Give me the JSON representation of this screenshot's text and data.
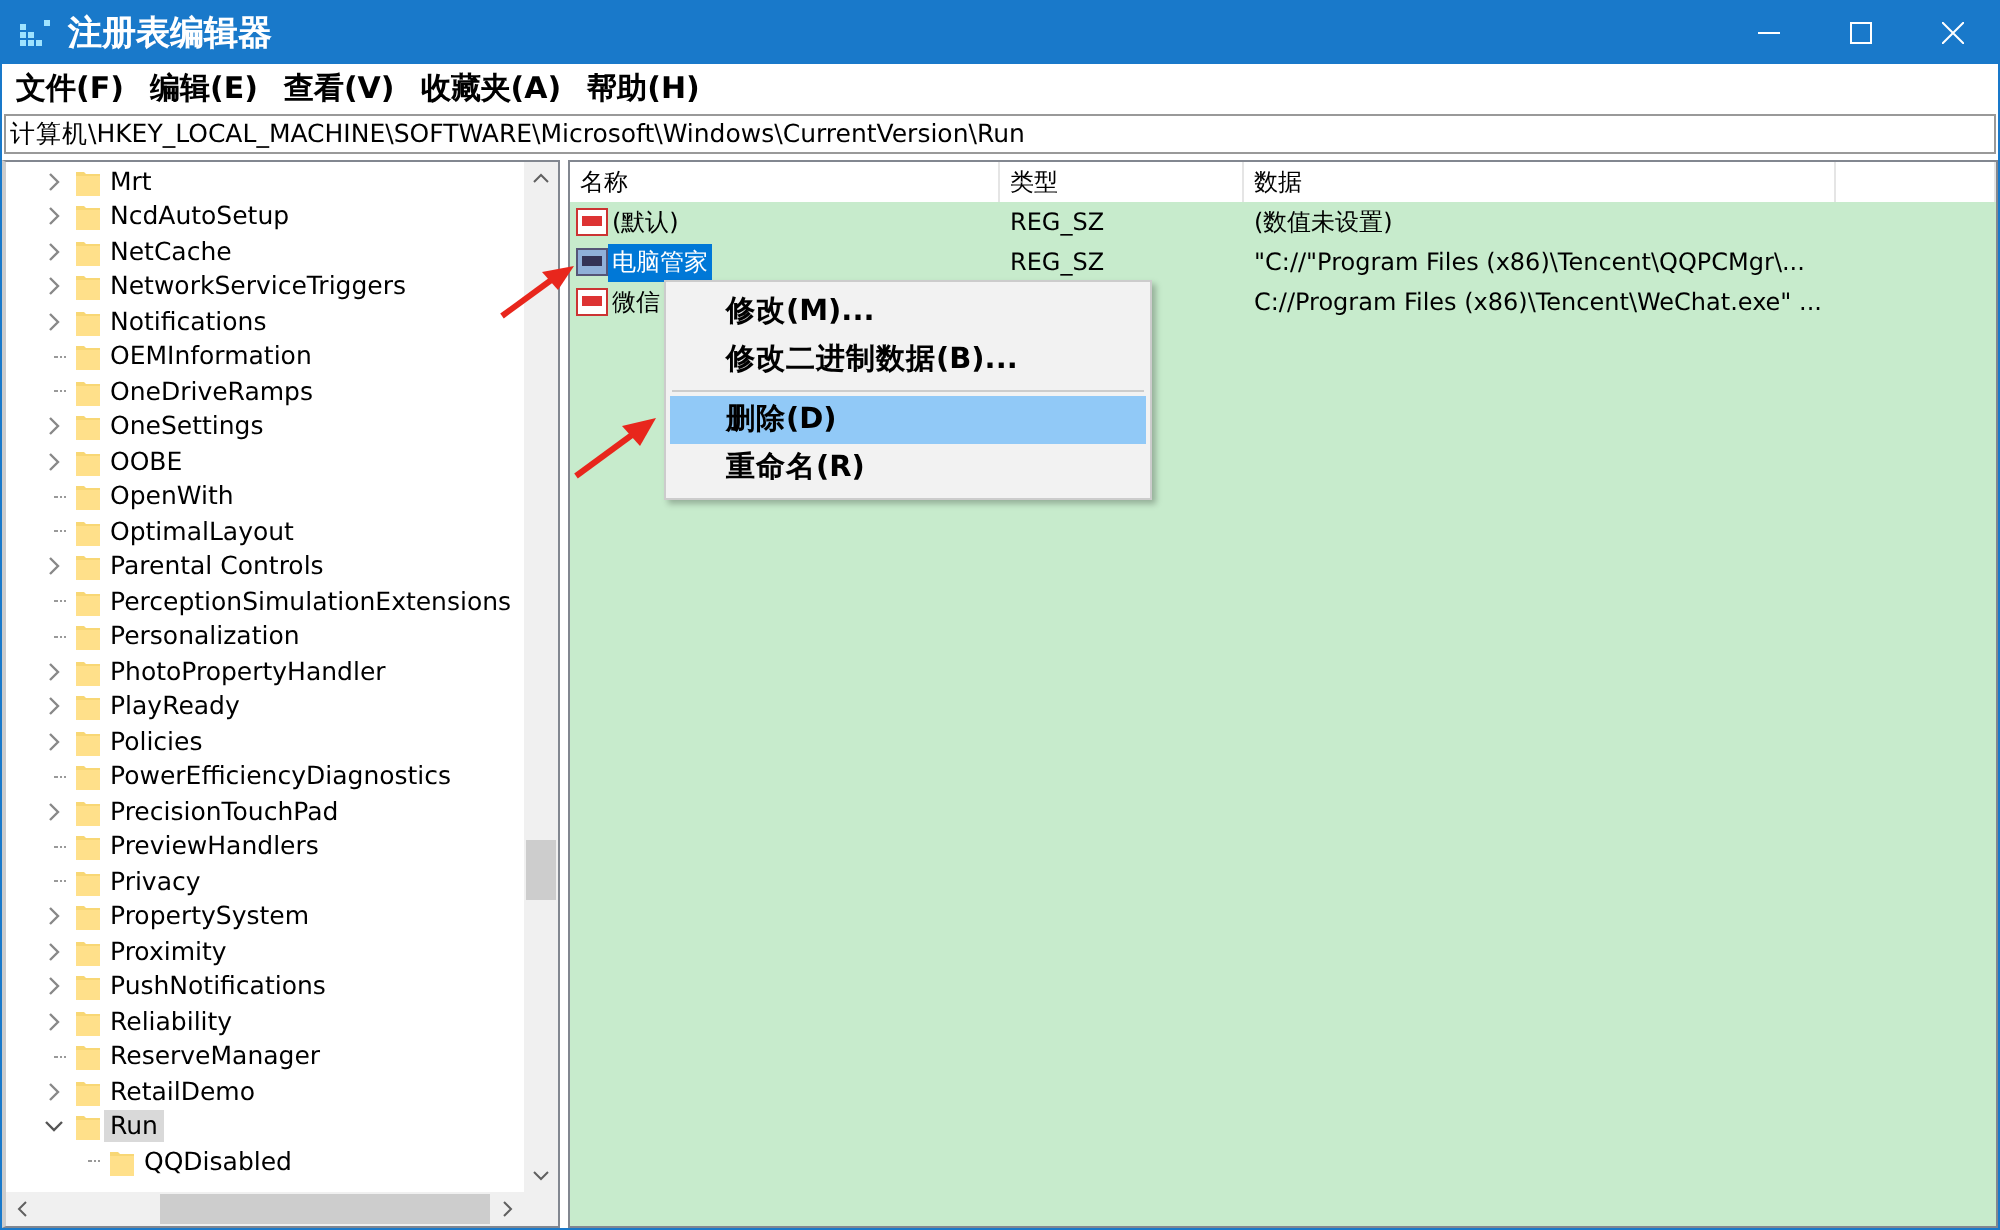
{
  "window": {
    "title": "注册表编辑器"
  },
  "menu_bar": [
    {
      "label": "文件(F)"
    },
    {
      "label": "编辑(E)"
    },
    {
      "label": "查看(V)"
    },
    {
      "label": "收藏夹(A)"
    },
    {
      "label": "帮助(H)"
    }
  ],
  "address_bar": {
    "value": "计算机\\HKEY_LOCAL_MACHINE\\SOFTWARE\\Microsoft\\Windows\\CurrentVersion\\Run"
  },
  "tree": {
    "items": [
      {
        "label": "Mrt",
        "expandable": true,
        "expanded": false,
        "selected": false
      },
      {
        "label": "NcdAutoSetup",
        "expandable": true,
        "expanded": false,
        "selected": false
      },
      {
        "label": "NetCache",
        "expandable": true,
        "expanded": false,
        "selected": false
      },
      {
        "label": "NetworkServiceTriggers",
        "expandable": true,
        "expanded": false,
        "selected": false
      },
      {
        "label": "Notifications",
        "expandable": true,
        "expanded": false,
        "selected": false
      },
      {
        "label": "OEMInformation",
        "expandable": false,
        "selected": false
      },
      {
        "label": "OneDriveRamps",
        "expandable": false,
        "selected": false
      },
      {
        "label": "OneSettings",
        "expandable": true,
        "expanded": false,
        "selected": false
      },
      {
        "label": "OOBE",
        "expandable": true,
        "expanded": false,
        "selected": false
      },
      {
        "label": "OpenWith",
        "expandable": false,
        "selected": false
      },
      {
        "label": "OptimalLayout",
        "expandable": false,
        "selected": false
      },
      {
        "label": "Parental Controls",
        "expandable": true,
        "expanded": false,
        "selected": false
      },
      {
        "label": "PerceptionSimulationExtensions",
        "expandable": false,
        "selected": false
      },
      {
        "label": "Personalization",
        "expandable": false,
        "selected": false
      },
      {
        "label": "PhotoPropertyHandler",
        "expandable": true,
        "expanded": false,
        "selected": false
      },
      {
        "label": "PlayReady",
        "expandable": true,
        "expanded": false,
        "selected": false
      },
      {
        "label": "Policies",
        "expandable": true,
        "expanded": false,
        "selected": false
      },
      {
        "label": "PowerEfficiencyDiagnostics",
        "expandable": false,
        "selected": false
      },
      {
        "label": "PrecisionTouchPad",
        "expandable": true,
        "expanded": false,
        "selected": false
      },
      {
        "label": "PreviewHandlers",
        "expandable": false,
        "selected": false
      },
      {
        "label": "Privacy",
        "expandable": false,
        "selected": false
      },
      {
        "label": "PropertySystem",
        "expandable": true,
        "expanded": false,
        "selected": false
      },
      {
        "label": "Proximity",
        "expandable": true,
        "expanded": false,
        "selected": false
      },
      {
        "label": "PushNotifications",
        "expandable": true,
        "expanded": false,
        "selected": false
      },
      {
        "label": "Reliability",
        "expandable": true,
        "expanded": false,
        "selected": false
      },
      {
        "label": "ReserveManager",
        "expandable": false,
        "selected": false
      },
      {
        "label": "RetailDemo",
        "expandable": true,
        "expanded": false,
        "selected": false
      },
      {
        "label": "Run",
        "expandable": true,
        "expanded": true,
        "selected": true,
        "children": [
          {
            "label": "QQDisabled",
            "expandable": false,
            "selected": false
          }
        ]
      }
    ]
  },
  "values": {
    "columns": [
      "名称",
      "类型",
      "数据"
    ],
    "rows": [
      {
        "name": "(默认)",
        "type": "REG_SZ",
        "data": "(数值未设置)",
        "selected": false
      },
      {
        "name": "电脑管家",
        "type": "REG_SZ",
        "data": "\"C://\"Program Files (x86)\\Tencent\\QQPCMgr\\...",
        "selected": true
      },
      {
        "name": "微信",
        "data": "C://Program Files (x86)\\Tencent\\WeChat.exe\" ...",
        "selected": false
      }
    ]
  },
  "context_menu": {
    "items": [
      {
        "kind": "item",
        "label": "修改(M)...",
        "selected": false
      },
      {
        "kind": "item",
        "label": "修改二进制数据(B)...",
        "selected": false
      },
      {
        "kind": "separator"
      },
      {
        "kind": "item",
        "label": "删除(D)",
        "selected": true
      },
      {
        "kind": "item",
        "label": "重命名(R)",
        "selected": false
      }
    ]
  }
}
